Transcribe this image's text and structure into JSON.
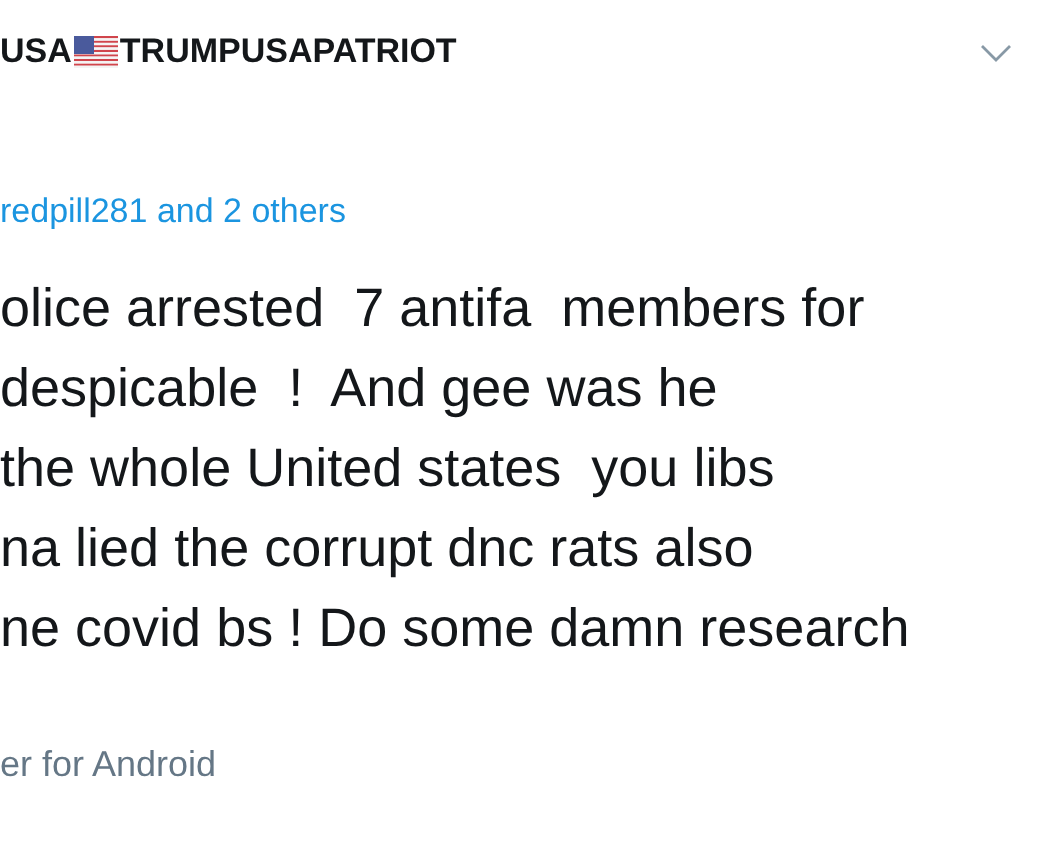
{
  "author": {
    "name_prefix": "USA",
    "name_suffix": "TRUMPUSAPATRIOT"
  },
  "replying_to": "redpill281 and 2 others",
  "tweet_lines": [
    "olice arrested  7 antifa  members for",
    "despicable  !  And gee was he",
    "the whole United states  you libs",
    "na lied the corrupt dnc rats also",
    "ne covid bs ! Do some damn research"
  ],
  "source": "er for Android"
}
